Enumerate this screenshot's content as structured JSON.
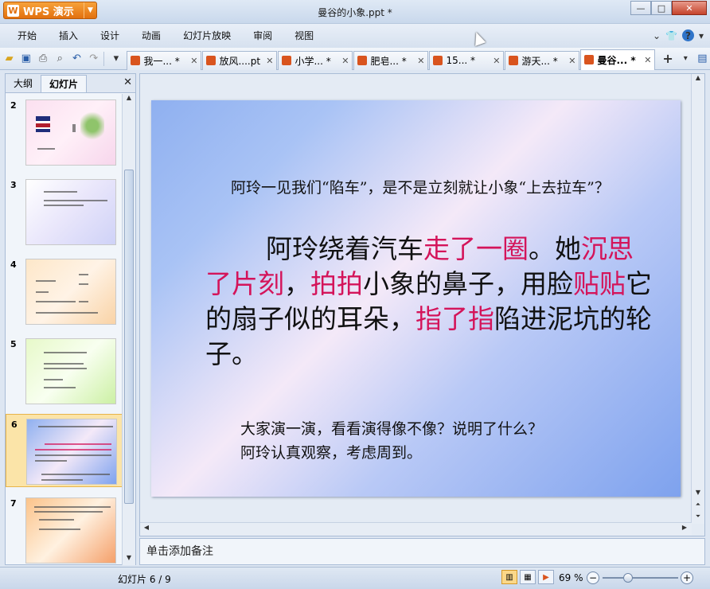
{
  "app": {
    "menu_button": "WPS 演示",
    "title": "曼谷的小象.ppt *"
  },
  "window": {
    "minimize": "—",
    "maximize": "□",
    "close": "✕"
  },
  "menu": [
    "开始",
    "插入",
    "设计",
    "动画",
    "幻灯片放映",
    "审阅",
    "视图"
  ],
  "doc_tabs": [
    {
      "label": "我一... *"
    },
    {
      "label": "放风....pt"
    },
    {
      "label": "小学... *"
    },
    {
      "label": "肥皂... *"
    },
    {
      "label": "15... *"
    },
    {
      "label": "游天... *"
    },
    {
      "label": "曼谷... *",
      "active": true
    }
  ],
  "left_panel": {
    "tab_outline": "大纲",
    "tab_slides": "幻灯片",
    "close": "✕"
  },
  "thumbnails": [
    {
      "num": "2"
    },
    {
      "num": "3"
    },
    {
      "num": "4"
    },
    {
      "num": "5"
    },
    {
      "num": "6",
      "selected": true
    },
    {
      "num": "7"
    }
  ],
  "slide": {
    "question": "阿玲一见我们“陷车”，是不是立刻就让小象“上去拉车”？",
    "body": {
      "p1": "阿玲绕着汽车",
      "h1": "走了一圈",
      "p2": "。她",
      "h2": "沉思了片刻",
      "p3": "，",
      "h3": "拍拍",
      "p4": "小象的鼻子，用脸",
      "h4": "贴贴",
      "p5": "它的扇子似的耳朵，",
      "h5": "指了指",
      "p6": "陷进泥坑的轮子。"
    },
    "foot1": "大家演一演，看看演得像不像？说明了什么？",
    "foot2": "阿玲认真观察，考虑周到。"
  },
  "notes": "单击添加备注",
  "status": {
    "slide_counter": "幻灯片 6 / 9",
    "zoom": "69 %"
  }
}
